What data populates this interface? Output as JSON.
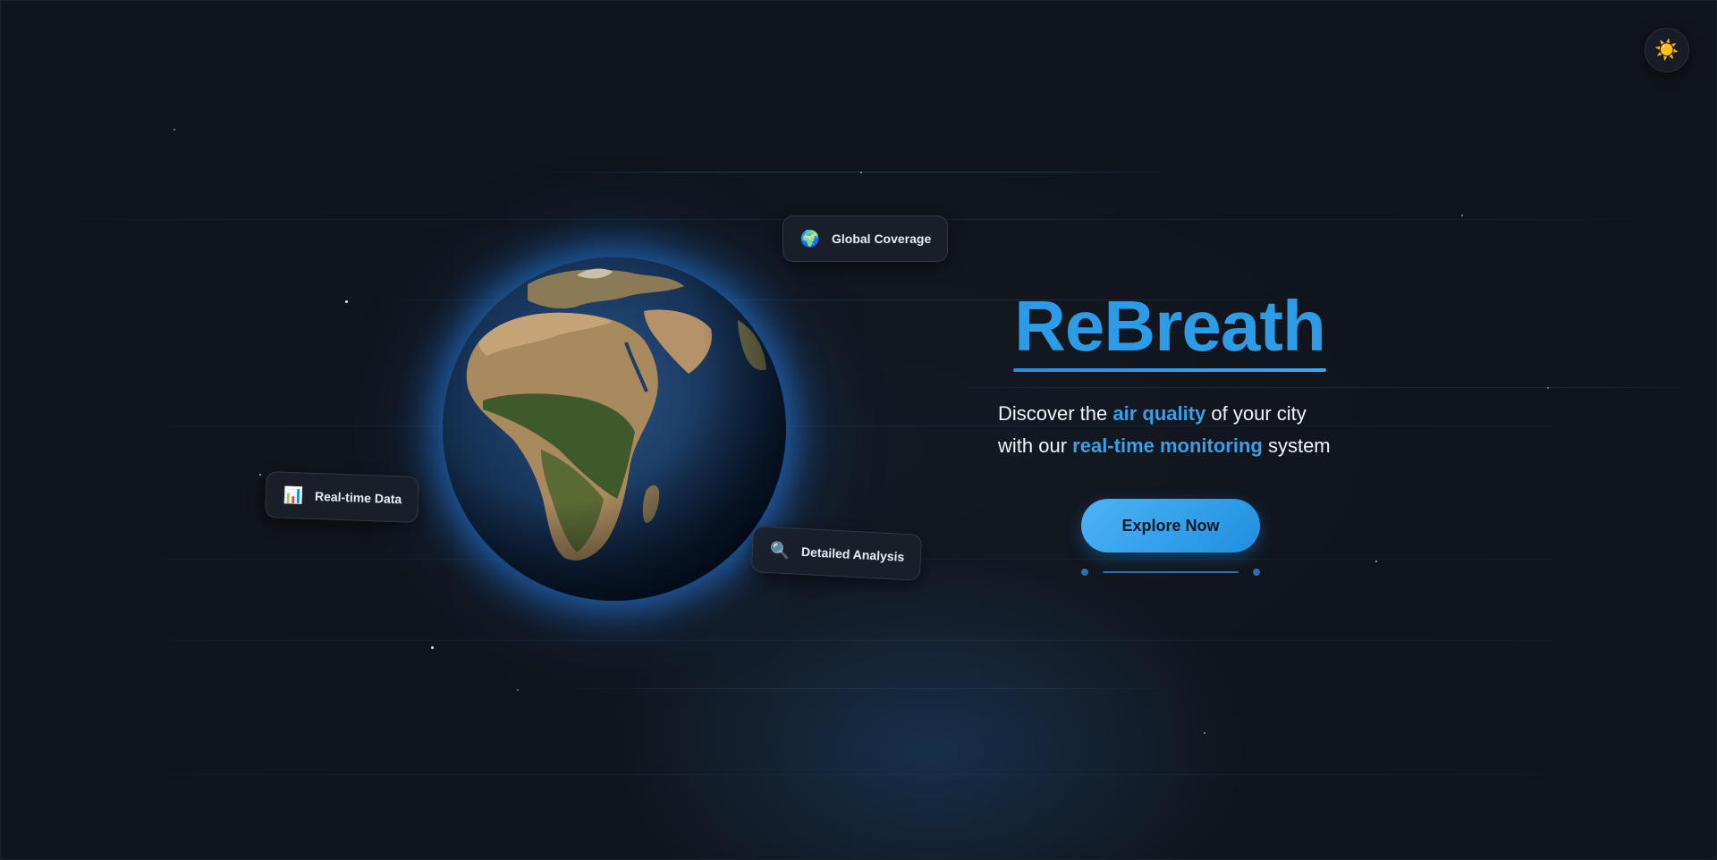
{
  "theme_toggle": {
    "icon": "sun-icon",
    "glyph": "☀️"
  },
  "hero": {
    "brand": "ReBreath",
    "tagline": {
      "line1_prefix": "Discover the ",
      "line1_highlight": "air quality",
      "line1_suffix": " of your city",
      "line2_prefix": "with our ",
      "line2_highlight": "real-time monitoring",
      "line2_suffix": " system"
    },
    "cta_label": "Explore Now"
  },
  "features": [
    {
      "label": "Global Coverage",
      "icon": "globe-icon",
      "glyph": "🌍"
    },
    {
      "label": "Real-time Data",
      "icon": "bar-chart-icon",
      "glyph": "📊"
    },
    {
      "label": "Detailed Analysis",
      "icon": "magnifier-icon",
      "glyph": "🔍"
    }
  ],
  "colors": {
    "background": "#10141b",
    "accent": "#2c9be8",
    "highlight": "#3a9fe6",
    "button": "#2b9de8"
  }
}
